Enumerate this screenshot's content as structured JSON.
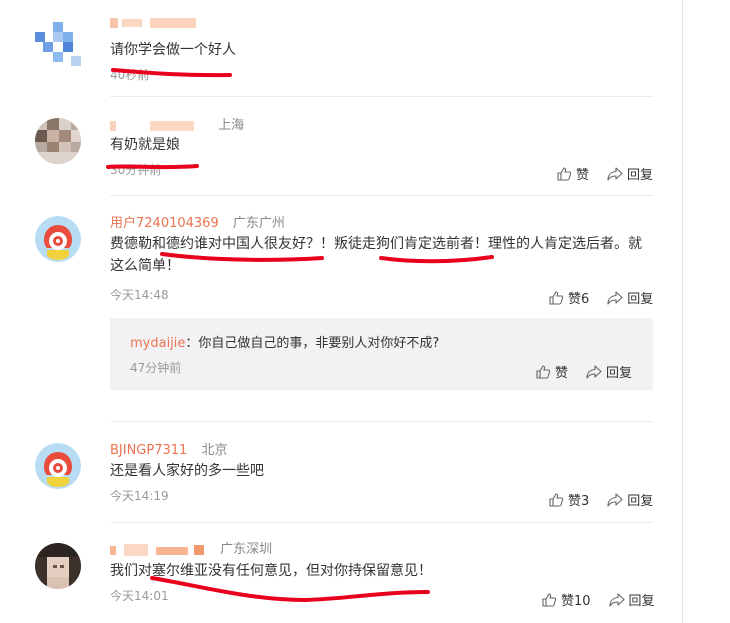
{
  "comments": [
    {
      "user": "",
      "location": "",
      "text": "请你学会做一个好人",
      "time": "40秒前"
    },
    {
      "user": "",
      "location": "上海",
      "text": "有奶就是娘",
      "time": "30分钟前",
      "like_label": "赞",
      "reply_label": "回复"
    },
    {
      "user": "用户7240104369",
      "location": "广东广州",
      "text": "费德勒和德约谁对中国人很友好？！叛徒走狗们肯定选前者！理性的人肯定选后者。就这么简单！",
      "time": "今天14:48",
      "like_label": "赞6",
      "reply_label": "回复",
      "sub_reply": {
        "user": "mydaijie",
        "text": "：你自己做自己的事，非要别人对你好不成?",
        "time": "47分钟前",
        "like_label": "赞",
        "reply_label": "回复"
      }
    },
    {
      "user": "BJINGP7311",
      "location": "北京",
      "text": "还是看人家好的多一些吧",
      "time": "今天14:19",
      "like_label": "赞3",
      "reply_label": "回复"
    },
    {
      "user": "",
      "location": "广东深圳",
      "text": "我们对塞尔维亚没有任何意见，但对你持保留意见！",
      "time": "今天14:01",
      "like_label": "赞10",
      "reply_label": "回复"
    }
  ],
  "colors": {
    "username": "#eb7350",
    "annotation": "#e8001c",
    "reply_bg": "#f2f2f5"
  },
  "icons": {
    "like": "thumbs-up-icon",
    "reply": "share-arrow-icon"
  }
}
